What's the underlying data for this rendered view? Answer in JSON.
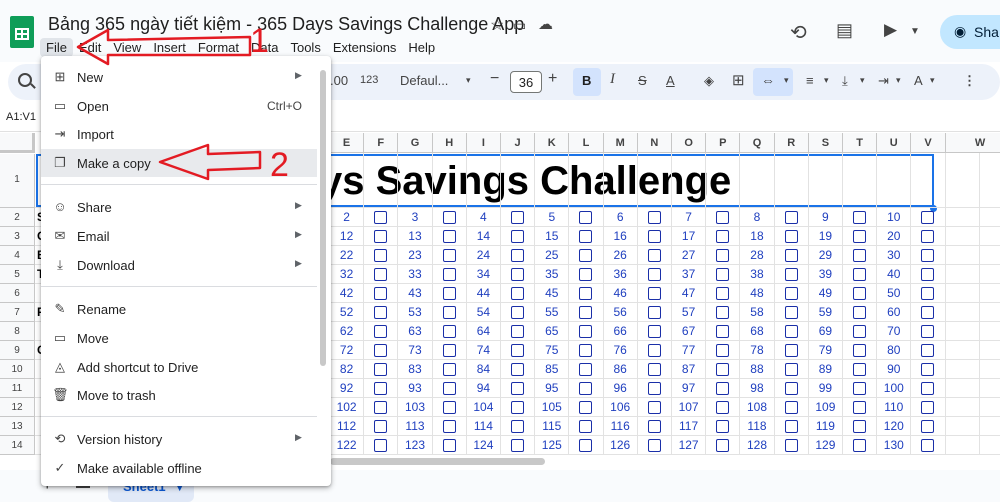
{
  "app": {
    "title": "Bảng 365 ngày tiết kiệm - 365 Days Savings Challenge App",
    "share_label": "Sha"
  },
  "menubar": [
    "File",
    "Edit",
    "View",
    "Insert",
    "Format",
    "Data",
    "Tools",
    "Extensions",
    "Help"
  ],
  "toolbar": {
    "decimal_label": ".00",
    "format_label": "123",
    "font_name": "Defaul...",
    "font_size": "36",
    "bold": "B"
  },
  "formula_bar": {
    "name_box": "A1:V1"
  },
  "columns": [
    "E",
    "F",
    "G",
    "H",
    "I",
    "J",
    "K",
    "L",
    "M",
    "N",
    "O",
    "P",
    "Q",
    "R",
    "S",
    "T",
    "U",
    "V",
    "W"
  ],
  "rows": [
    "1",
    "2",
    "3",
    "4",
    "5",
    "6",
    "7",
    "8",
    "9",
    "10",
    "11",
    "12",
    "13",
    "14"
  ],
  "banner_text": "ys Savings Challenge",
  "left_col_fragments": [
    "S",
    "C",
    "B",
    "T",
    "",
    "F",
    "",
    "C"
  ],
  "table_values": [
    [
      "2",
      "3",
      "4",
      "5",
      "6",
      "7",
      "8",
      "9",
      "10"
    ],
    [
      "12",
      "13",
      "14",
      "15",
      "16",
      "17",
      "18",
      "19",
      "20"
    ],
    [
      "22",
      "23",
      "24",
      "25",
      "26",
      "27",
      "28",
      "29",
      "30"
    ],
    [
      "32",
      "33",
      "34",
      "35",
      "36",
      "37",
      "38",
      "39",
      "40"
    ],
    [
      "42",
      "43",
      "44",
      "45",
      "46",
      "47",
      "48",
      "49",
      "50"
    ],
    [
      "52",
      "53",
      "54",
      "55",
      "56",
      "57",
      "58",
      "59",
      "60"
    ],
    [
      "62",
      "63",
      "64",
      "65",
      "66",
      "67",
      "68",
      "69",
      "70"
    ],
    [
      "72",
      "73",
      "74",
      "75",
      "76",
      "77",
      "78",
      "79",
      "80"
    ],
    [
      "82",
      "83",
      "84",
      "85",
      "86",
      "87",
      "88",
      "89",
      "90"
    ],
    [
      "92",
      "93",
      "94",
      "95",
      "96",
      "97",
      "98",
      "99",
      "100"
    ],
    [
      "102",
      "103",
      "104",
      "105",
      "106",
      "107",
      "108",
      "109",
      "110"
    ],
    [
      "112",
      "113",
      "114",
      "115",
      "116",
      "117",
      "118",
      "119",
      "120"
    ],
    [
      "122",
      "123",
      "124",
      "125",
      "126",
      "127",
      "128",
      "129",
      "130"
    ]
  ],
  "file_menu": {
    "new": "New",
    "open": "Open",
    "open_shortcut": "Ctrl+O",
    "import": "Import",
    "make_copy": "Make a copy",
    "share": "Share",
    "email": "Email",
    "download": "Download",
    "rename": "Rename",
    "move": "Move",
    "add_shortcut": "Add shortcut to Drive",
    "move_trash": "Move to trash",
    "version_history": "Version history",
    "make_offline": "Make available offline"
  },
  "sheet_tab": "Sheet1",
  "annotations": {
    "step1": "1",
    "step2": "2",
    "color": "#e31b23"
  }
}
